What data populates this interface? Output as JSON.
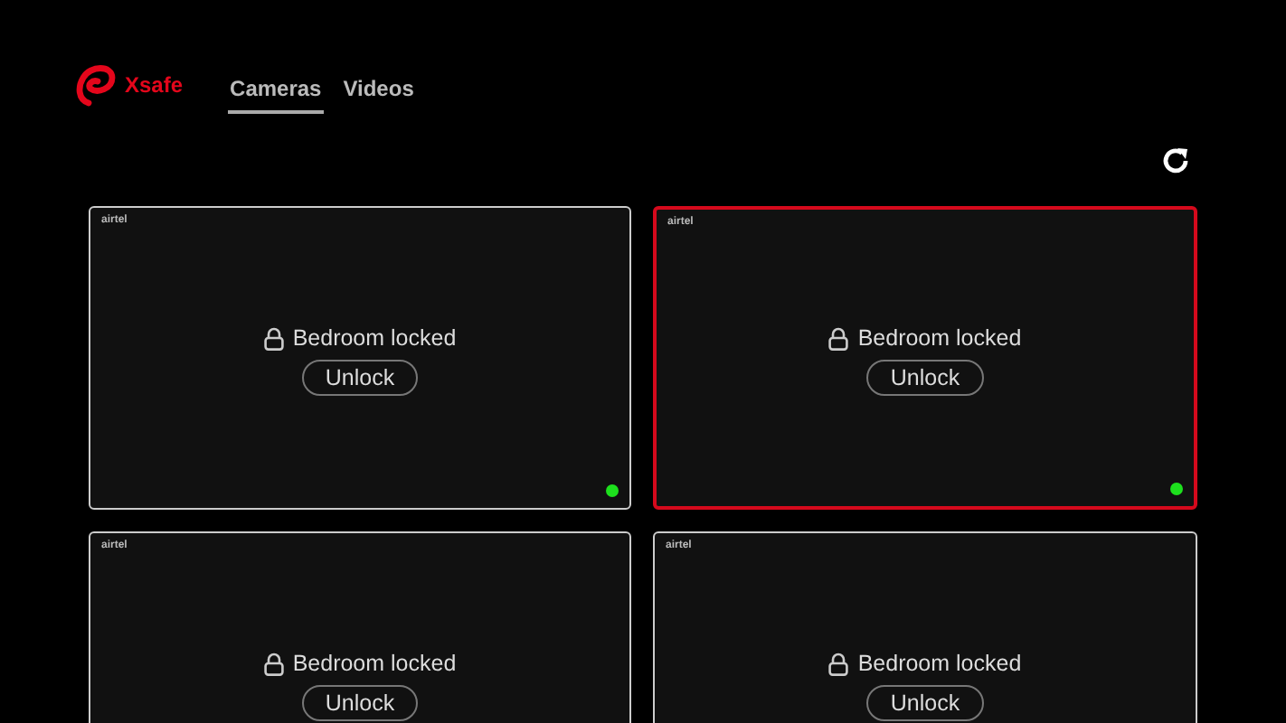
{
  "app": {
    "name": "Xsafe"
  },
  "tabs": [
    {
      "label": "Cameras",
      "selected": true
    },
    {
      "label": "Videos",
      "selected": false
    }
  ],
  "cameras": [
    {
      "brand": "airtel",
      "status": "Bedroom locked",
      "action": "Unlock",
      "selected": false,
      "online": true
    },
    {
      "brand": "airtel",
      "status": "Bedroom locked",
      "action": "Unlock",
      "selected": true,
      "online": true
    },
    {
      "brand": "airtel",
      "status": "Bedroom locked",
      "action": "Unlock",
      "selected": false
    },
    {
      "brand": "airtel",
      "status": "Bedroom locked",
      "action": "Unlock",
      "selected": false
    }
  ]
}
